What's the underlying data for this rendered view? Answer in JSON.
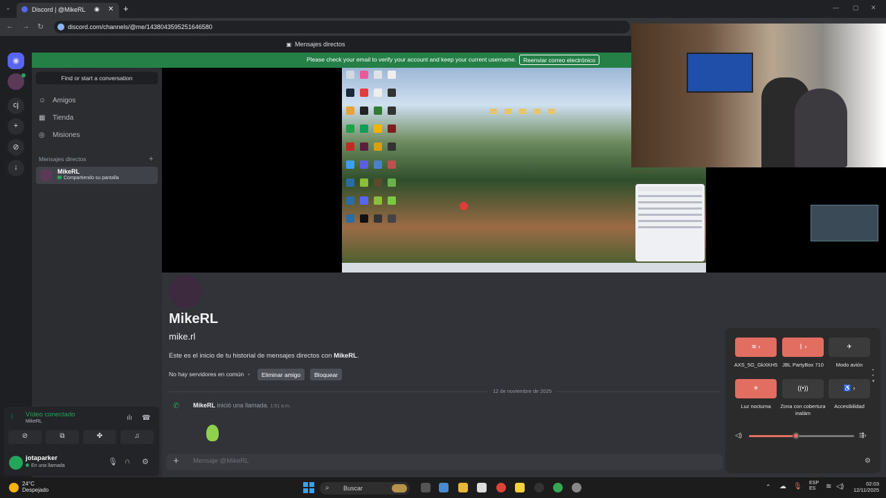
{
  "browser": {
    "tab_title": "Discord | @MikeRL",
    "url": "discord.com/channels/@me/1438043595251646580"
  },
  "discord": {
    "title": "Mensajes directos",
    "banner_text": "Please check your email to verify your account and keep your current username.",
    "banner_button": "Reenviar correo electrónico"
  },
  "sidebar": {
    "search_label": "Find or start a conversation",
    "nav": [
      {
        "label": "Amigos",
        "icon": "friends-icon"
      },
      {
        "label": "Tienda",
        "icon": "shop-icon"
      },
      {
        "label": "Misiones",
        "icon": "quests-icon"
      }
    ],
    "dm_header": "Mensajes directos",
    "dm": {
      "name": "MikeRL",
      "status": "Compartiendo su pantalla"
    }
  },
  "voice": {
    "connected": "Vídeo conectado",
    "channel": "MikeRL"
  },
  "user": {
    "name": "jotaparker",
    "status": "En una llamada"
  },
  "profile": {
    "display_name": "MikeRL",
    "handle": "mike.rl",
    "intro_prefix": "Este es el inicio de tu historial de mensajes directos con ",
    "intro_name": "MikeRL",
    "intro_suffix": ".",
    "servers": "No hay servidores en común",
    "remove_friend": "Eliminar amigo",
    "block": "Bloquear"
  },
  "messages": {
    "date": "12 de noviembre de 2025",
    "call_user": "MikeRL",
    "call_text": " inició una llamada.",
    "call_time": "1:51 a.m."
  },
  "composer": {
    "placeholder": "Mensaje @MikeRL"
  },
  "quick_settings": {
    "tiles": [
      {
        "label": "AXS_5G_GkXKH5",
        "icon": "wifi-icon",
        "active": true
      },
      {
        "label": "JBL PartyBox 710",
        "icon": "bluetooth-icon",
        "active": true
      },
      {
        "label": "Modo avión",
        "icon": "airplane-icon",
        "active": false
      },
      {
        "label": "Luz nocturna",
        "icon": "night-light-icon",
        "active": true
      },
      {
        "label": "Zona con cobertura inalám",
        "icon": "hotspot-icon",
        "active": false
      },
      {
        "label": "Accesibilidad",
        "icon": "accessibility-icon",
        "active": false
      }
    ],
    "volume": 0.45
  },
  "taskbar": {
    "temp": "24°C",
    "weather": "Despejado",
    "search": "Buscar",
    "lang1": "ESP",
    "lang2": "ES",
    "time": "02:03",
    "date": "12/11/2025"
  },
  "colors": {
    "discord_bg": "#313338",
    "sidebar_bg": "#2b2d31",
    "banner_green": "#248046",
    "online_green": "#23a55a",
    "qs_accent": "#e26e62"
  }
}
